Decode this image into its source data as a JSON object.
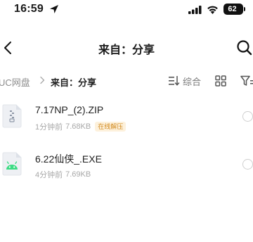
{
  "status_bar": {
    "time": "16:59",
    "battery": "62"
  },
  "nav": {
    "title": "来自：分享"
  },
  "breadcrumb": {
    "root": "UC网盘",
    "current": "来自：分享"
  },
  "toolbar": {
    "sort_label": "综合"
  },
  "files": [
    {
      "name": "7.17NP_(2).ZIP",
      "time": "1分钟前",
      "size": "7.68KB",
      "badge": "在线解压",
      "icon": "zip-file-icon"
    },
    {
      "name": "6.22仙侠_.EXE",
      "time": "4分钟前",
      "size": "7.69KB",
      "icon": "android-app-icon"
    }
  ],
  "colors": {
    "badge_text": "#d18a1f",
    "badge_bg": "#fdf1dc",
    "android_green": "#3ddc84"
  }
}
